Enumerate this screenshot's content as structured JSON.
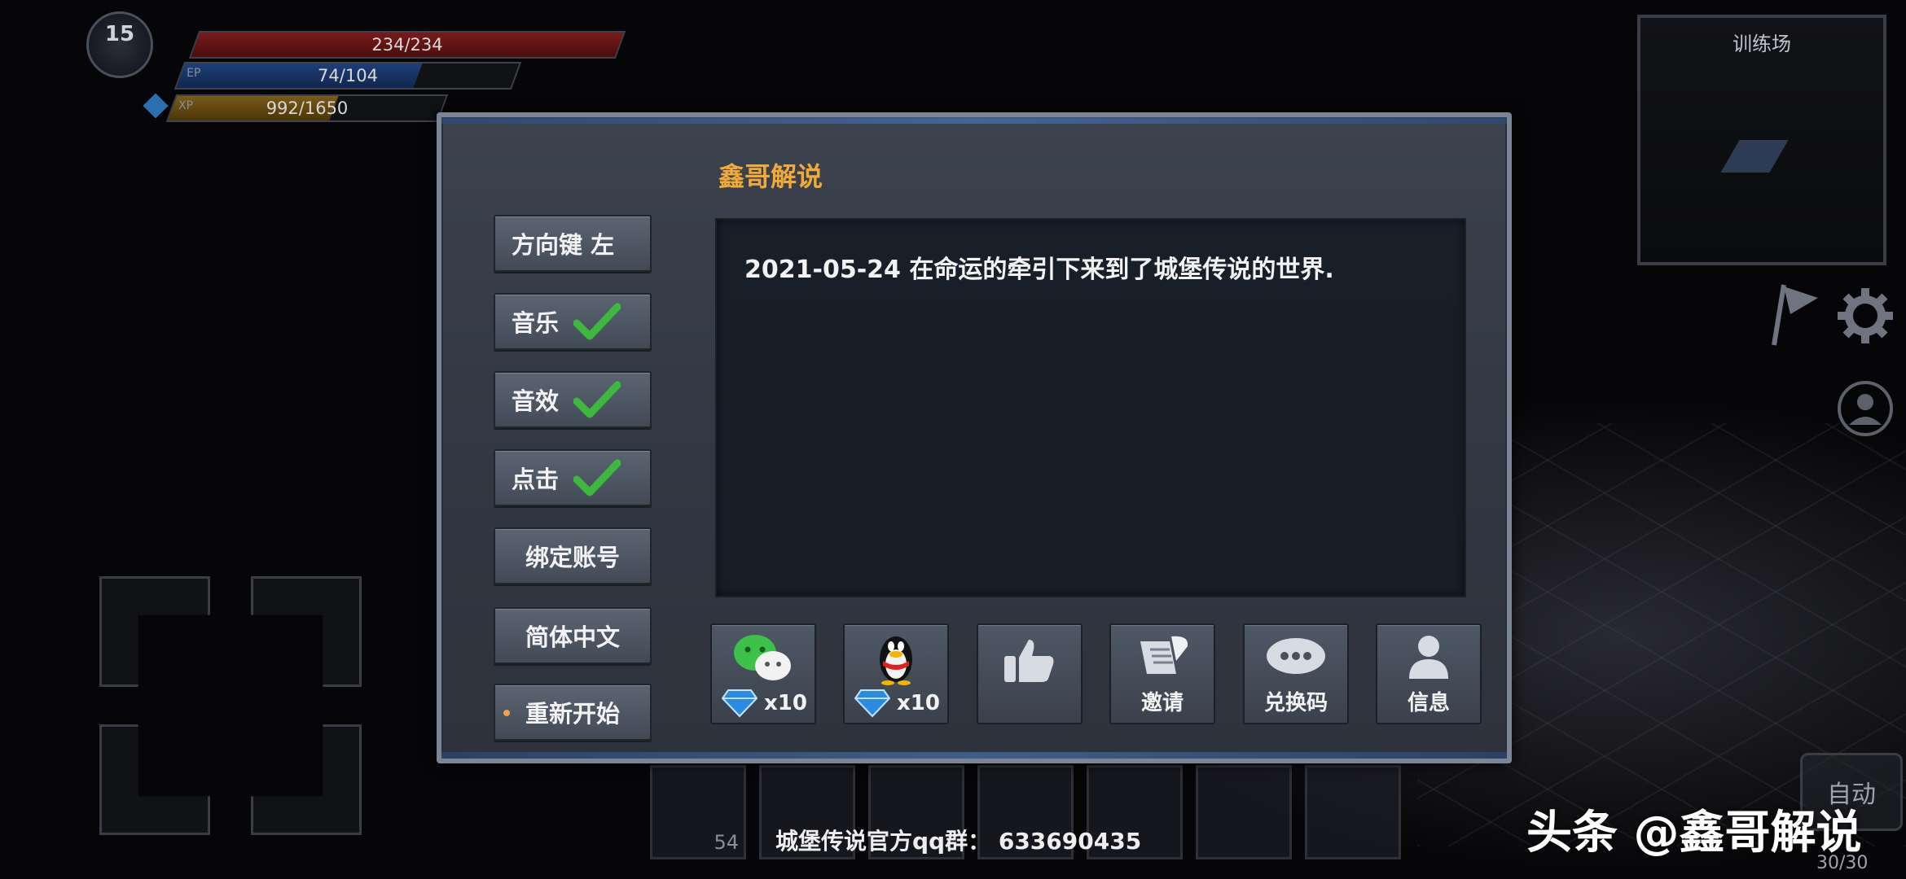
{
  "hud": {
    "level": "15",
    "hp": "234/234",
    "hp_fraction": 1.0,
    "ep_tag": "EP",
    "ep": "74/104",
    "ep_fraction": 0.71,
    "xp_tag": "XP",
    "xp": "992/1650",
    "xp_fraction": 0.6
  },
  "minimap": {
    "title": "训练场"
  },
  "dialog": {
    "title": "鑫哥解说",
    "menu": {
      "direction": "方向键 左",
      "music": "音乐",
      "sfx": "音效",
      "click": "点击",
      "bind": "绑定账号",
      "language": "简体中文",
      "restart": "重新开始"
    },
    "toggles": {
      "music": true,
      "sfx": true,
      "click": true
    },
    "message": "2021-05-24 在命运的牵引下来到了城堡传说的世界.",
    "share": {
      "wechat_reward": "x10",
      "qq_reward": "x10",
      "invite": "邀请",
      "redeem": "兑换码",
      "info": "信息"
    }
  },
  "bottom": {
    "qq_group": "城堡传说官方qq群：  633690435",
    "slot_counts": [
      "54"
    ],
    "page_count": "30/30",
    "auto": "自动"
  },
  "watermark": "头条 @鑫哥解说",
  "colors": {
    "title_orange": "#f1a93a",
    "check_green": "#3fb83f",
    "diamond_blue": "#2a8be0"
  }
}
